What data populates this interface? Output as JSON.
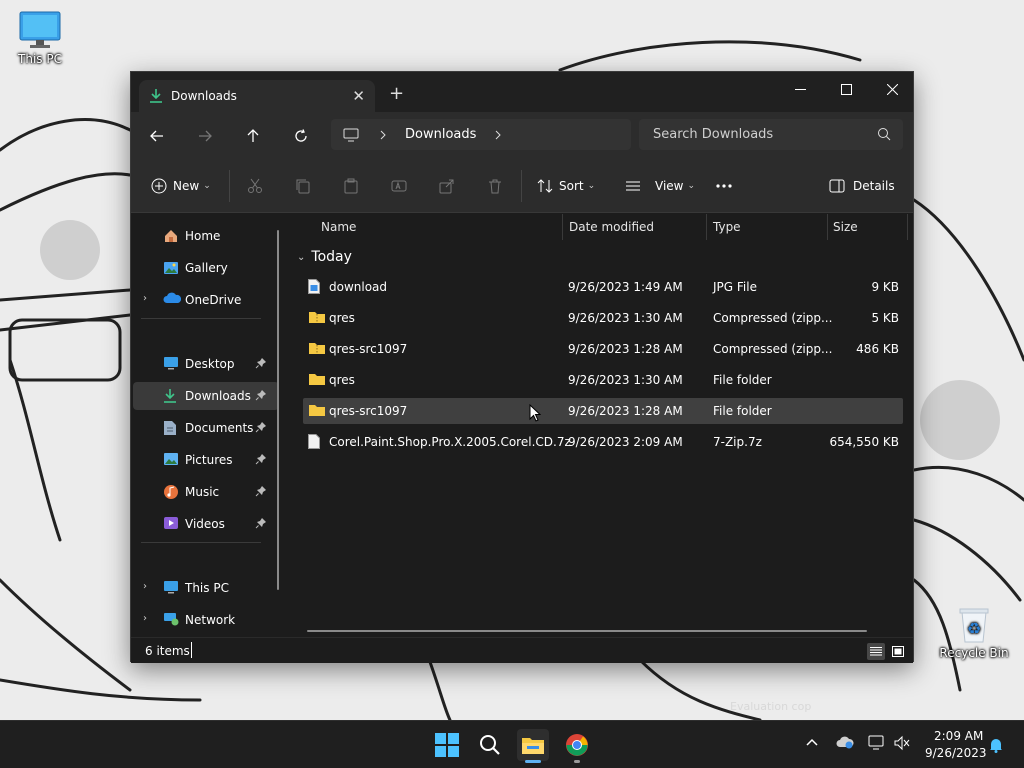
{
  "desktop": {
    "icons": [
      {
        "label": "This PC"
      },
      {
        "label": "Recycle Bin"
      }
    ],
    "watermark": "Evaluation cop"
  },
  "window": {
    "tab_title": "Downloads",
    "address": {
      "crumbs": [
        "Downloads"
      ]
    },
    "search_placeholder": "Search Downloads",
    "toolbar": {
      "new_label": "New",
      "sort_label": "Sort",
      "view_label": "View",
      "details_label": "Details"
    },
    "sidebar": {
      "items": [
        {
          "label": "Home",
          "icon": "home-icon"
        },
        {
          "label": "Gallery",
          "icon": "gallery-icon"
        },
        {
          "label": "OneDrive",
          "icon": "onedrive-icon"
        },
        {
          "label": "Desktop",
          "icon": "desktop-icon"
        },
        {
          "label": "Downloads",
          "icon": "downloads-icon"
        },
        {
          "label": "Documents",
          "icon": "documents-icon"
        },
        {
          "label": "Pictures",
          "icon": "pictures-icon"
        },
        {
          "label": "Music",
          "icon": "music-icon"
        },
        {
          "label": "Videos",
          "icon": "videos-icon"
        },
        {
          "label": "This PC",
          "icon": "this-pc-icon"
        },
        {
          "label": "Network",
          "icon": "network-icon"
        }
      ]
    },
    "columns": {
      "name": "Name",
      "date": "Date modified",
      "type": "Type",
      "size": "Size"
    },
    "group": "Today",
    "files": [
      {
        "name": "download",
        "date": "9/26/2023 1:49 AM",
        "type": "JPG File",
        "size": "9 KB",
        "icon": "jpg-file-icon"
      },
      {
        "name": "qres",
        "date": "9/26/2023 1:30 AM",
        "type": "Compressed (zipp...",
        "size": "5 KB",
        "icon": "zip-folder-icon"
      },
      {
        "name": "qres-src1097",
        "date": "9/26/2023 1:28 AM",
        "type": "Compressed (zipp...",
        "size": "486 KB",
        "icon": "zip-folder-icon"
      },
      {
        "name": "qres",
        "date": "9/26/2023 1:30 AM",
        "type": "File folder",
        "size": "",
        "icon": "folder-icon"
      },
      {
        "name": "qres-src1097",
        "date": "9/26/2023 1:28 AM",
        "type": "File folder",
        "size": "",
        "icon": "folder-icon"
      },
      {
        "name": "Corel.Paint.Shop.Pro.X.2005.Corel.CD.7z",
        "date": "9/26/2023 2:09 AM",
        "type": "7-Zip.7z",
        "size": "654,550 KB",
        "icon": "file-icon"
      }
    ],
    "status": {
      "count": "6 items"
    }
  },
  "taskbar": {
    "time": "2:09 AM",
    "date": "9/26/2023"
  },
  "colors": {
    "accent": "#5fb2f2",
    "window_bg": "#1c1c1c",
    "chrome_bg": "#2c2c2c",
    "folder_yellow": "#f5c842"
  }
}
